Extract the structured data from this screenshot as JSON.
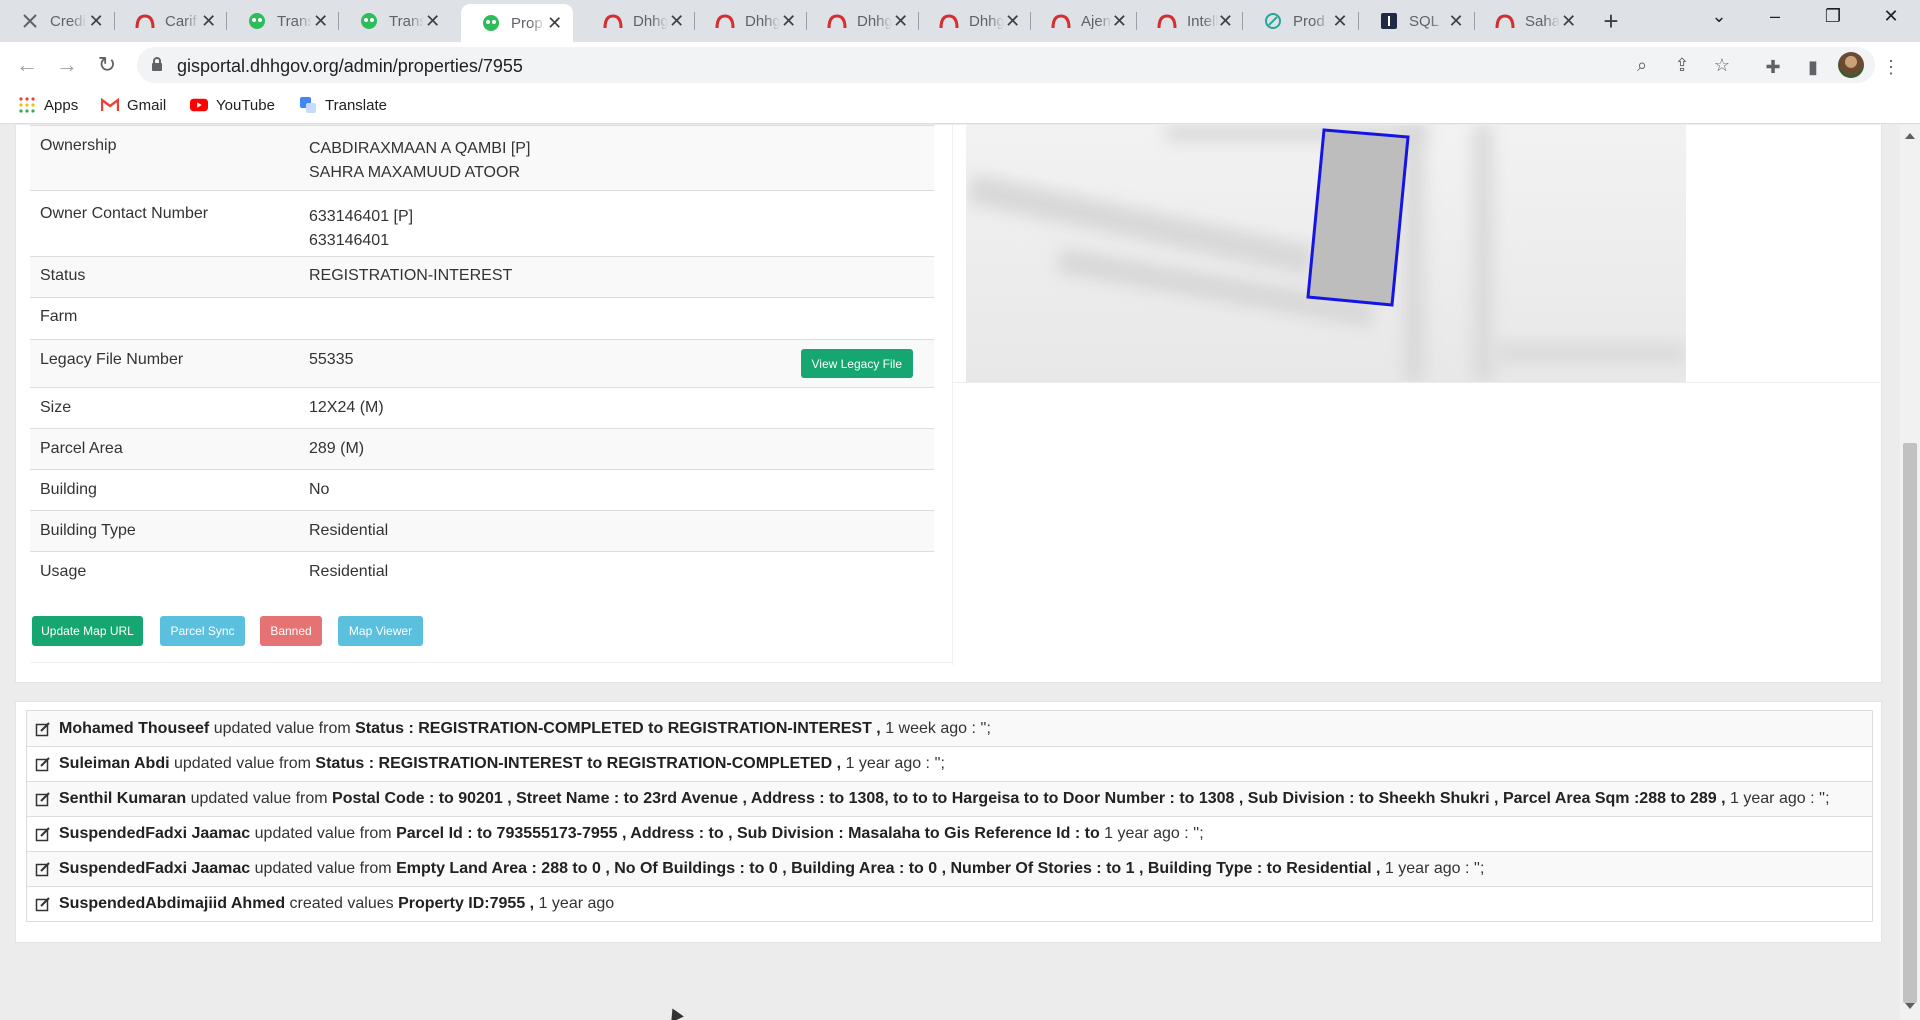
{
  "browser": {
    "tabs": [
      {
        "label": "Credi",
        "icon": "tools-icon"
      },
      {
        "label": "Carif",
        "icon": "dhh-logo-icon"
      },
      {
        "label": "Trans",
        "icon": "pi-logo-icon"
      },
      {
        "label": "Trans",
        "icon": "pi-logo-icon"
      },
      {
        "label": "Prop",
        "icon": "pi-logo-icon",
        "active": true
      },
      {
        "label": "Dhhg",
        "icon": "dhh-logo-icon"
      },
      {
        "label": "Dhhg",
        "icon": "dhh-logo-icon"
      },
      {
        "label": "Dhhg",
        "icon": "dhh-logo-icon"
      },
      {
        "label": "Dhhg",
        "icon": "dhh-logo-icon"
      },
      {
        "label": "Ajen",
        "icon": "dhh-logo-icon"
      },
      {
        "label": "Intell",
        "icon": "dhh-logo-icon"
      },
      {
        "label": "Prod",
        "icon": "swirl-icon"
      },
      {
        "label": "SQL",
        "icon": "sql-icon"
      },
      {
        "label": "Saha",
        "icon": "dhh-logo-icon"
      }
    ],
    "url": "gisportal.dhhgov.org/admin/properties/7955",
    "bookmarks": [
      {
        "label": "Apps",
        "icon": "apps-grid-icon"
      },
      {
        "label": "Gmail",
        "icon": "gmail-icon"
      },
      {
        "label": "YouTube",
        "icon": "youtube-icon"
      },
      {
        "label": "Translate",
        "icon": "translate-icon"
      }
    ]
  },
  "property": {
    "ownership_label": "Ownership",
    "ownership_lines": [
      "CABDIRAXMAAN A QAMBI [P]",
      "SAHRA MAXAMUUD ATOOR"
    ],
    "contact_label": "Owner Contact Number",
    "contact_lines": [
      "633146401 [P]",
      "633146401"
    ],
    "status_label": "Status",
    "status_value": "REGISTRATION-INTEREST",
    "farm_label": "Farm",
    "farm_value": "",
    "legacy_label": "Legacy File Number",
    "legacy_value": "55335",
    "legacy_button": "View Legacy File",
    "size_label": "Size",
    "size_value": "12X24 (M)",
    "parcel_label": "Parcel Area",
    "parcel_value": "289 (M)",
    "building_label": "Building",
    "building_value": "No",
    "building_type_label": "Building Type",
    "building_type_value": "Residential",
    "usage_label": "Usage",
    "usage_value": "Residential"
  },
  "actions": {
    "update_map": "Update Map URL",
    "parcel_sync": "Parcel Sync",
    "banned": "Banned",
    "map_viewer": "Map Viewer"
  },
  "colors": {
    "success": "#15a672",
    "info": "#5bc0de",
    "danger": "#e57373",
    "parcel_outline": "#1414e6",
    "parcel_fill": "#bdbdbd"
  },
  "log": [
    {
      "user": "Mohamed Thouseef",
      "verb": "updated value from",
      "change": "Status : REGISTRATION-COMPLETED to REGISTRATION-INTEREST ,",
      "when": "1 week ago : '';"
    },
    {
      "user": "Suleiman Abdi",
      "verb": "updated value from",
      "change": "Status : REGISTRATION-INTEREST to REGISTRATION-COMPLETED ,",
      "when": "1 year ago : '';"
    },
    {
      "user": "Senthil Kumaran",
      "verb": "updated value from",
      "change": "Postal Code : to 90201 , Street Name : to 23rd Avenue , Address : to 1308, to to to Hargeisa to to Door Number : to 1308 , Sub Division : to Sheekh Shukri , Parcel Area Sqm :288 to 289 ,",
      "when": "1 year ago : '';"
    },
    {
      "user": "SuspendedFadxi Jaamac",
      "verb": "updated value from",
      "change": "Parcel Id : to 793555173-7955 , Address : to , Sub Division : Masalaha to Gis Reference Id : to",
      "when": "1 year ago : '';"
    },
    {
      "user": "SuspendedFadxi Jaamac",
      "verb": "updated value from",
      "change": "Empty Land Area : 288 to 0 , No Of Buildings : to 0 , Building Area : to 0 , Number Of Stories : to 1 , Building Type : to Residential ,",
      "when": "1 year ago : '';"
    },
    {
      "user": "SuspendedAbdimajiid Ahmed",
      "verb": "created values",
      "change": "Property ID:7955 ,",
      "when": "1 year ago"
    }
  ]
}
